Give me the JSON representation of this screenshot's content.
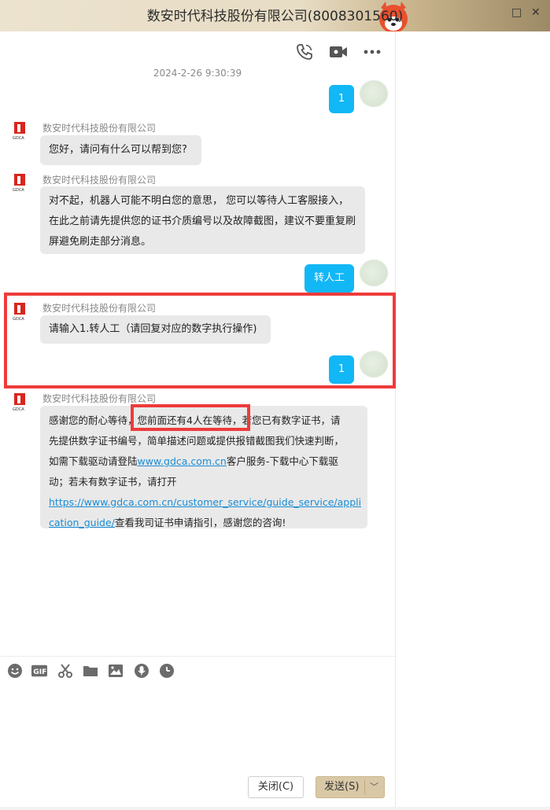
{
  "window": {
    "title": "数安时代科技股份有限公司(8008301560)"
  },
  "chat": {
    "timestamp": "2024-2-26 9:30:39",
    "sender_name": "数安时代科技股份有限公司",
    "messages": [
      {
        "from": "me",
        "text": "1"
      },
      {
        "from": "agent",
        "sender": "数安时代科技股份有限公司",
        "text": "您好，请问有什么可以帮到您?"
      },
      {
        "from": "agent",
        "sender": "数安时代科技股份有限公司",
        "lines": [
          "对不起，机器人可能不明白您的意思， 您可以等待人工客服接入，",
          "在此之前请先提供您的证书介质编号以及故障截图，建议不要重复刷",
          "屏避免刷走部分消息。"
        ]
      },
      {
        "from": "me",
        "text": "转人工"
      },
      {
        "from": "agent",
        "sender": "数安时代科技股份有限公司",
        "text": "请输入1.转人工（请回复对应的数字执行操作)"
      },
      {
        "from": "me",
        "text": "1"
      },
      {
        "from": "agent",
        "sender": "数安时代科技股份有限公司",
        "line1_a": "感谢您的耐心等待，",
        "line1_highlight": "您前面还有4人在等待，",
        "line1_b": "若您已有数字证书，请",
        "line2": "先提供数字证书编号，简单描述问题或提供报错截图我们快速判断，",
        "line3_a": "如需下载驱动请登陆",
        "line3_link": "www.gdca.com.cn",
        "line3_b": "客户服务-下载中心下载驱",
        "line4": "动；若未有数字证书，请打开",
        "line5_link": "https://www.gdca.com.cn/customer_service/guide_service/appli",
        "line6_link": "cation_guide/",
        "line6_b": "查看我司证书申请指引，感谢您的咨询!"
      }
    ]
  },
  "logo_text": "GDCA",
  "buttons": {
    "close": "关闭(C)",
    "send": "发送(S)"
  },
  "icons": {
    "phone": "phone-icon",
    "video": "video-icon",
    "more": "more-icon",
    "emoji": "emoji-icon",
    "gif": "GIF",
    "scissors": "scissors-icon",
    "folder": "folder-icon",
    "image": "image-icon",
    "mic": "mic-icon",
    "history": "clock-icon"
  },
  "colors": {
    "accent": "#12b7f5",
    "bubble_in": "#e9e9e9",
    "highlight_box": "#ee3b3b",
    "link": "#1a8ed6",
    "send_button": "#d9c8a6"
  }
}
